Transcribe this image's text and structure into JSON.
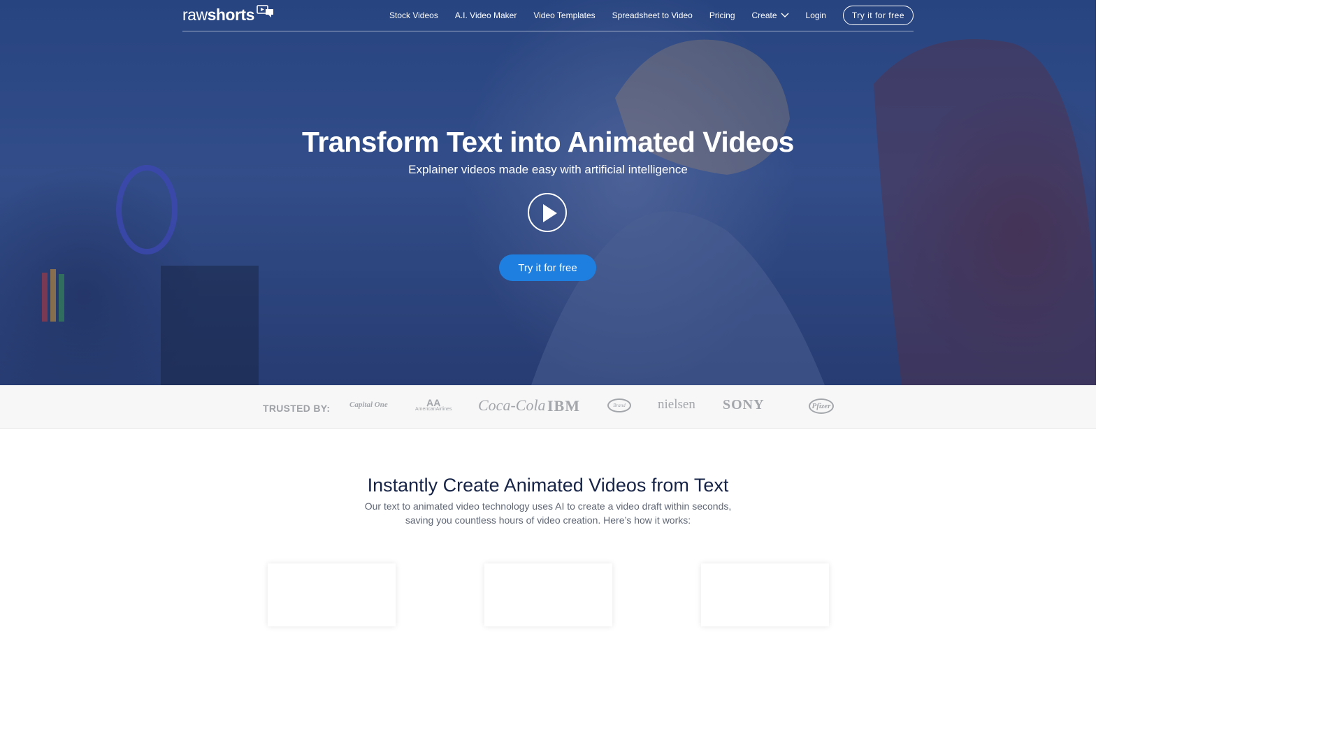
{
  "nav": {
    "logo_raw": "raw",
    "logo_shorts": "shorts",
    "links": [
      "Stock Videos",
      "A.I. Video Maker",
      "Video Templates",
      "Spreadsheet to Video",
      "Pricing",
      "Create",
      "Login"
    ],
    "cta_label": "Try it for free"
  },
  "hero": {
    "title": "Transform Text into Animated Videos",
    "subtitle": "Explainer videos made easy with artificial intelligence",
    "cta_label": "Try it for free"
  },
  "trusted": {
    "label": "TRUSTED BY:",
    "brands": {
      "capital_one": "Capital One",
      "aa_mark": "AA",
      "american_airlines": "AmericanAirlines",
      "coca_cola": "Coca-Cola",
      "ibm": "IBM",
      "oval_brand": "Brand",
      "nielsen": "nielsen",
      "sony": "SONY",
      "pfizer": "Pfizer"
    }
  },
  "section": {
    "title": "Instantly Create Animated Videos from Text",
    "text_line1": "Our text to animated video technology uses AI to create a video draft within seconds,",
    "text_line2": "saving you countless hours of video creation. Here’s how it works:"
  },
  "colors": {
    "accent": "#1e7fe0",
    "hero_tint": "#2c4a86",
    "heading": "#172447"
  },
  "icons": [
    "logo-chat-icon",
    "chevron-down-icon",
    "play-icon"
  ]
}
